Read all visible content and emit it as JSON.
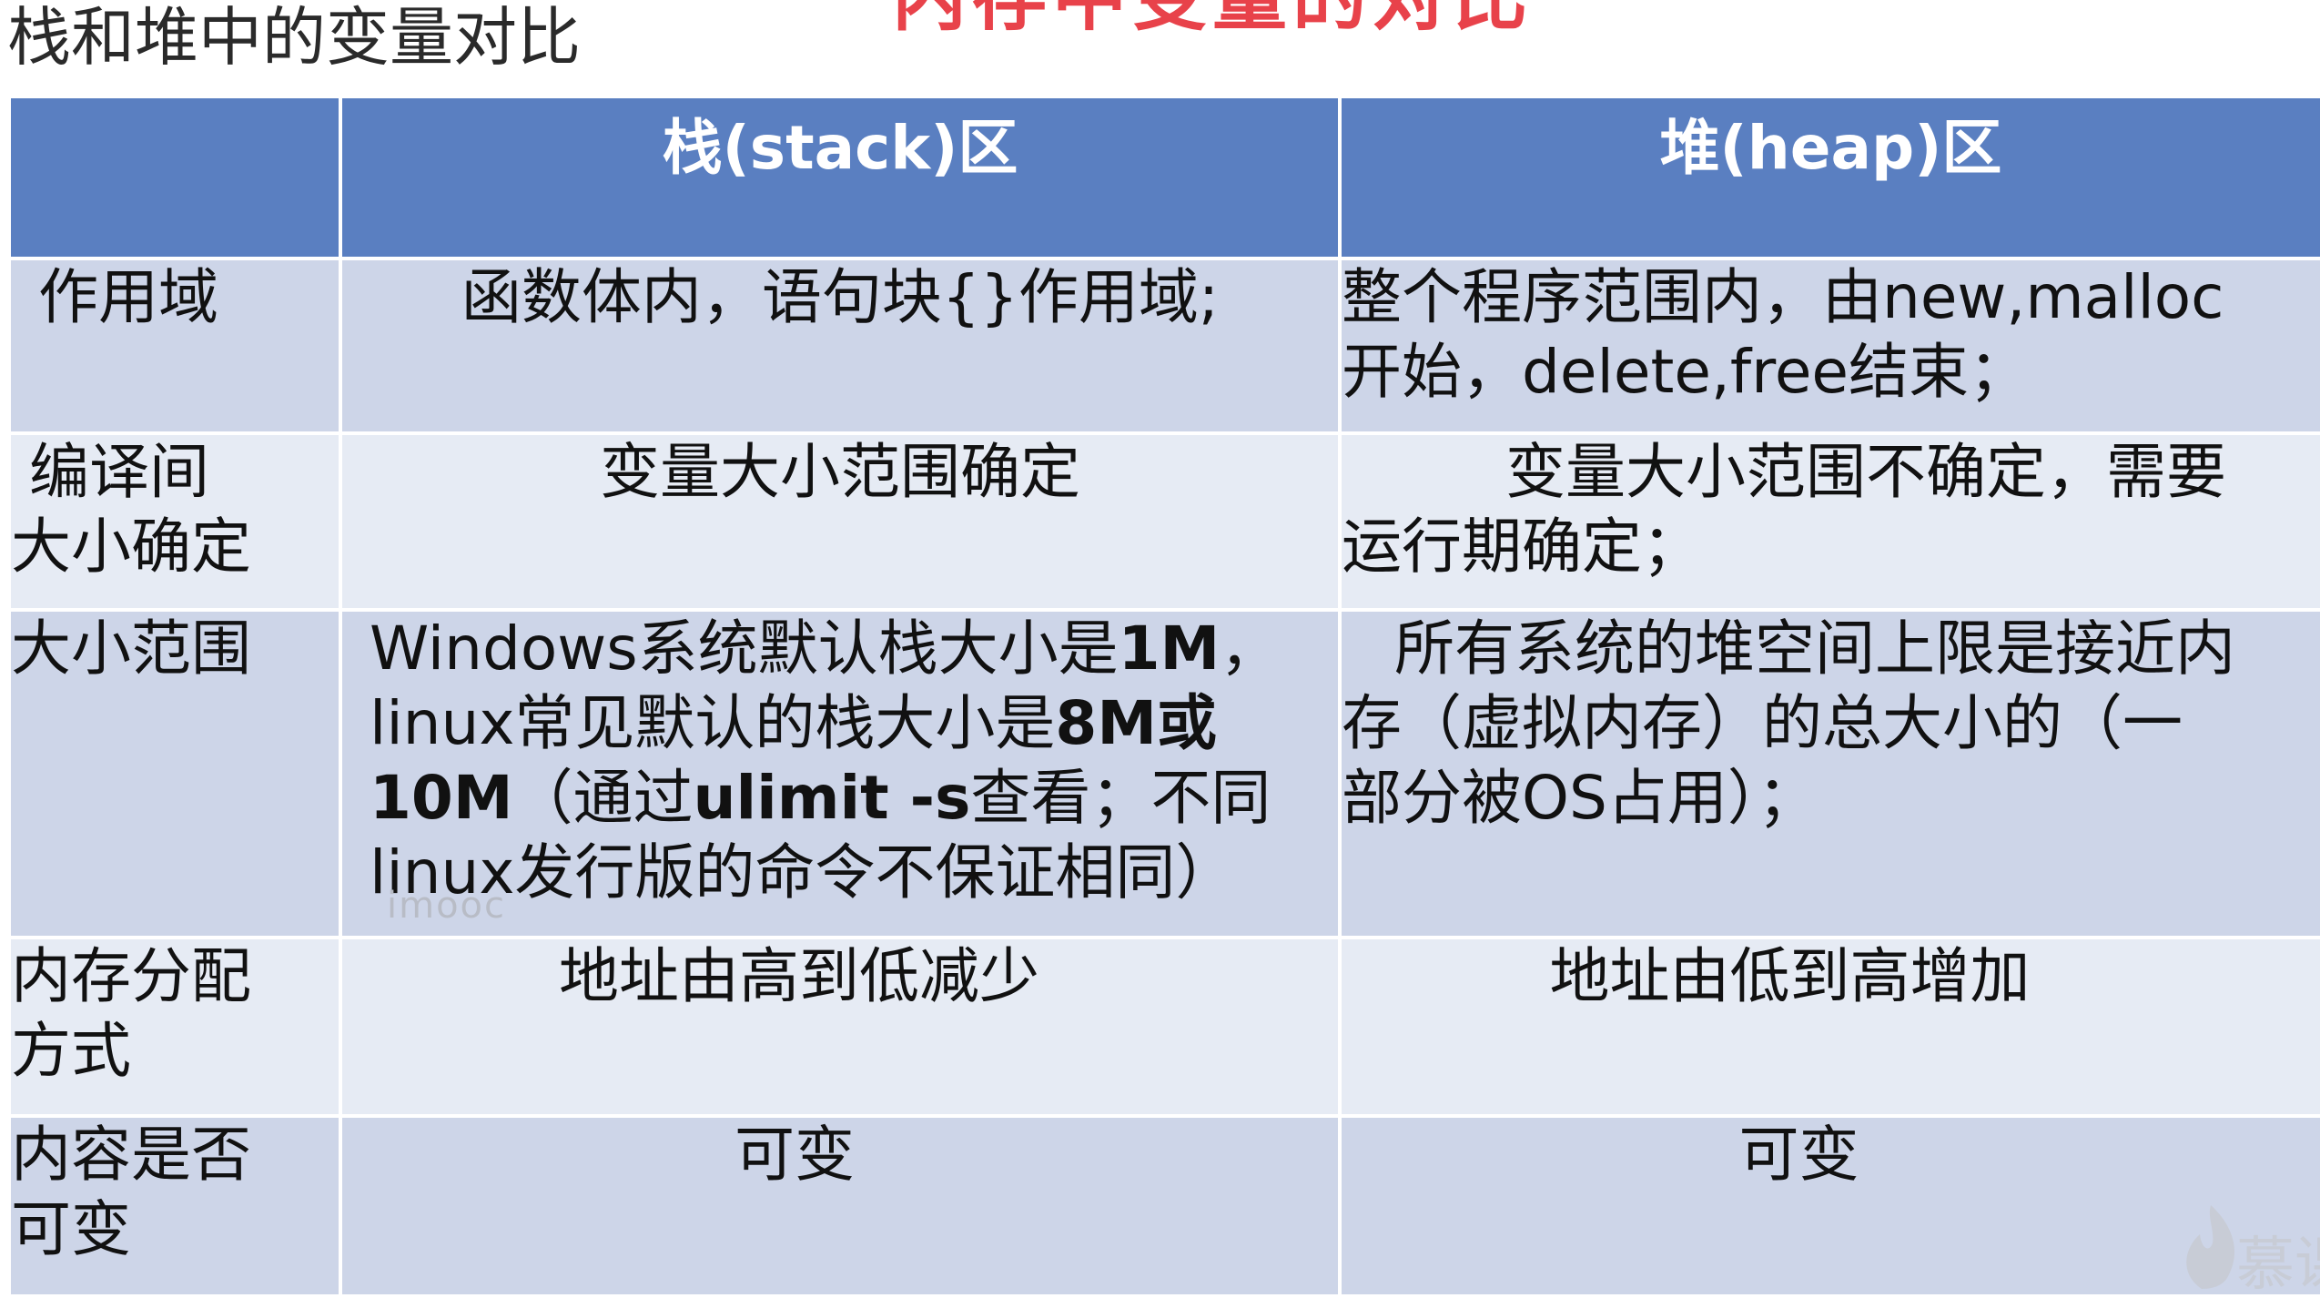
{
  "slide": {
    "title_partial": "内存中变量的对比",
    "subtitle": "栈和堆中的变量对比"
  },
  "table": {
    "headers": [
      "",
      "栈(stack)区",
      "堆(heap)区"
    ],
    "rows": [
      {
        "label": "作用域",
        "stack": [
          "函数体内，语句块{}作用域;"
        ],
        "heap": [
          "整个程序范围内，由new,malloc",
          "开始，delete,free结束；"
        ]
      },
      {
        "label": "编译间大小确定",
        "label_lines": [
          "编译间",
          "大小确定"
        ],
        "stack": [
          "变量大小范围确定"
        ],
        "heap": [
          "变量大小范围不确定，需要",
          "运行期确定；"
        ]
      },
      {
        "label": "大小范围",
        "stack": [
          "Windows系统默认栈大小是",
          "1M",
          "，",
          "linux常见默认的栈大小是",
          "8M或",
          "10M",
          "（通过",
          "ulimit -s",
          "查看；不同",
          "linux发行版的命令不保证相同）"
        ],
        "heap": [
          "所有系统的堆空间上限是接近内",
          "存（虚拟内存）的总大小的（一",
          "部分被OS占用）；"
        ]
      },
      {
        "label": "内存分配方式",
        "label_lines": [
          "内存分配",
          "方式"
        ],
        "stack": [
          "地址由高到低减少"
        ],
        "heap": [
          "地址由低到高增加"
        ]
      },
      {
        "label": "内容是否可变",
        "label_lines": [
          "内容是否",
          "可变"
        ],
        "stack": [
          "可变"
        ],
        "heap": [
          "可变"
        ]
      }
    ]
  },
  "watermark": {
    "small_text": "imooc",
    "logo_text": "慕课"
  },
  "colors": {
    "header_bg": "#5a7fc1",
    "row_dark": "#cdd5e8",
    "row_light": "#e6ebf4",
    "title_red": "#e8424a"
  }
}
